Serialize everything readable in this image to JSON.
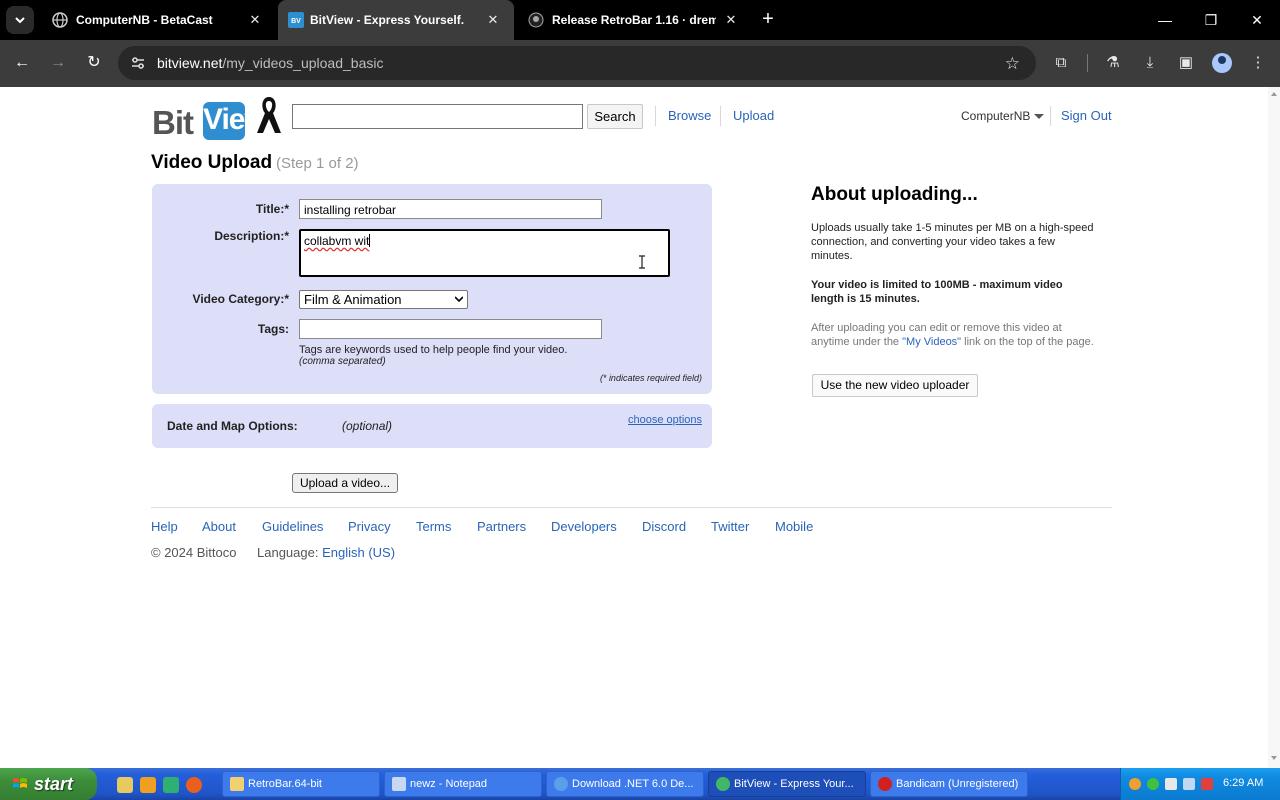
{
  "browser": {
    "tabs": [
      {
        "title": "ComputerNB - BetaCast",
        "active": false
      },
      {
        "title": "BitView - Express Yourself.",
        "active": true
      },
      {
        "title": "Release RetroBar 1.16 · dremin",
        "active": false
      }
    ],
    "url_host": "bitview.net",
    "url_path": "/my_videos_upload_basic"
  },
  "site": {
    "logo_bit": "Bit",
    "logo_view": "View",
    "search_button": "Search",
    "nav": {
      "browse": "Browse",
      "upload": "Upload"
    },
    "user": "ComputerNB",
    "sign_out": "Sign Out"
  },
  "upload": {
    "heading": "Video Upload",
    "step": "(Step 1 of 2)",
    "title_label": "Title:*",
    "title_value": "installing retrobar",
    "description_label": "Description:*",
    "description_value": "collabvm wit",
    "category_label": "Video Category:*",
    "category_value": "Film & Animation",
    "tags_label": "Tags:",
    "tags_value": "",
    "tags_help": "Tags are keywords used to help people find your video.",
    "tags_help2": "(comma separated)",
    "required_note": "(* indicates required field)",
    "date_map_label": "Date and Map Options:",
    "date_map_optional": "(optional)",
    "choose_options": "choose options",
    "upload_button": "Upload a video..."
  },
  "about": {
    "heading": "About uploading...",
    "p1": "Uploads usually take 1-5 minutes per MB on a high-speed connection, and converting your video takes a few minutes.",
    "p2": "Your video is limited to 100MB - maximum video length is 15 minutes.",
    "p3_before": "After uploading you can edit or remove this video at anytime under the ",
    "p3_link": "\"My Videos\"",
    "p3_after": " link on the top of the page.",
    "new_uploader_button": "Use the new video uploader"
  },
  "footer": {
    "links": [
      "Help",
      "About",
      "Guidelines",
      "Privacy",
      "Terms",
      "Partners",
      "Developers",
      "Discord",
      "Twitter",
      "Mobile"
    ],
    "copyright": "© 2024 Bittoco",
    "language_label": "Language:",
    "language_value": "English (US)"
  },
  "taskbar": {
    "start": "start",
    "tasks": [
      "RetroBar.64-bit",
      "newz - Notepad",
      "Download .NET 6.0 De...",
      "BitView - Express Your...",
      "Bandicam (Unregistered)"
    ],
    "clock": "6:29 AM"
  },
  "colors": {
    "link": "#2a64b8",
    "form_bg": "#dddff8",
    "logo_blue": "#2e8ecf",
    "taskbar_blue": "#245edb",
    "start_green": "#3c8d3a"
  }
}
